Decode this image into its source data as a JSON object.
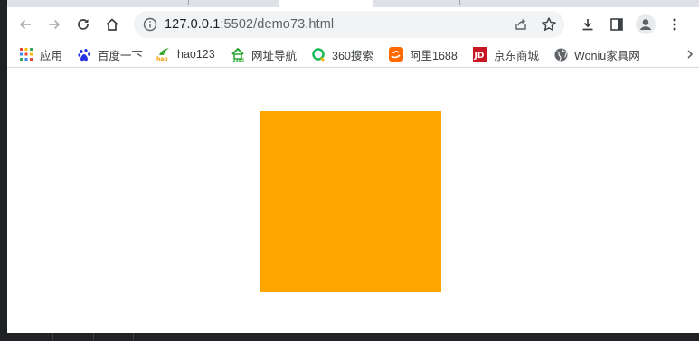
{
  "browser": {
    "url_host": "127.0.0.1",
    "url_rest": ":5502/demo73.html"
  },
  "bookmarks": [
    {
      "label": "应用",
      "icon": "apps-grid-icon"
    },
    {
      "label": "百度一下",
      "icon": "baidu-paw-icon"
    },
    {
      "label": "hao123",
      "icon": "hao123-icon"
    },
    {
      "label": "网址导航",
      "icon": "2345-nav-icon"
    },
    {
      "label": "360搜索",
      "icon": "360-search-icon"
    },
    {
      "label": "阿里1688",
      "icon": "alibaba-1688-icon"
    },
    {
      "label": "京东商城",
      "icon": "jd-icon"
    },
    {
      "label": "Woniu家具网",
      "icon": "globe-icon"
    }
  ],
  "page": {
    "box_color": "#FFA500"
  },
  "colors": {
    "toolbar_icon": "#5f6368",
    "omnibox_bg": "#f1f3f4",
    "tabstrip_bg": "#dee1e6"
  }
}
